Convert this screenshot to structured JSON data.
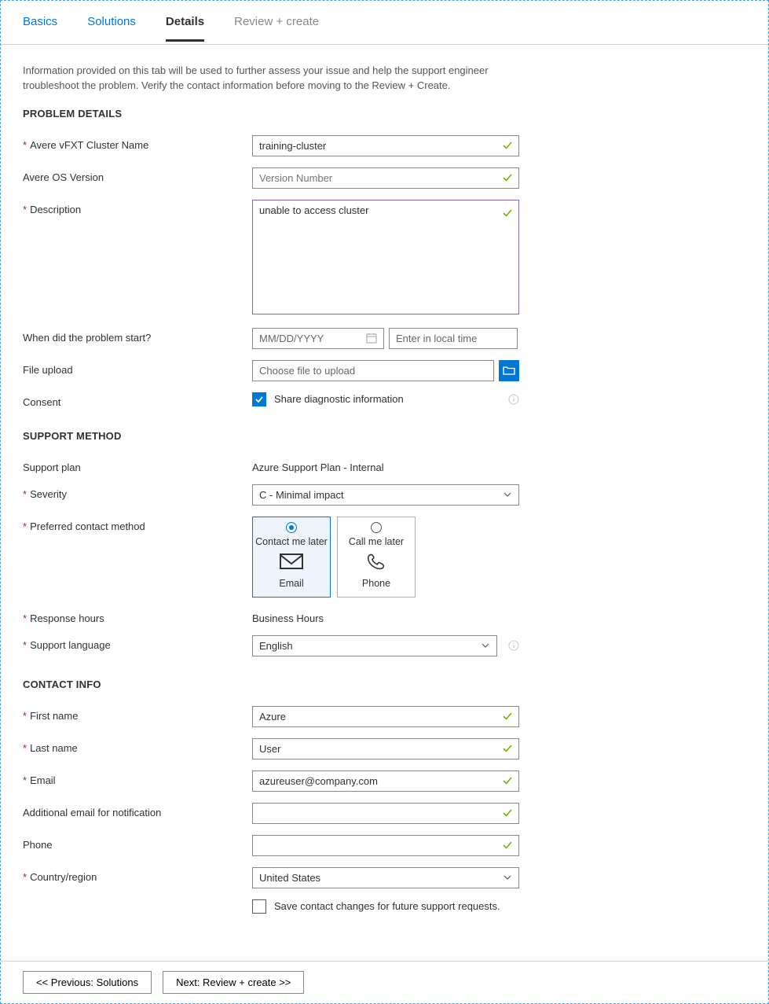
{
  "tabs": {
    "basics": "Basics",
    "solutions": "Solutions",
    "details": "Details",
    "review": "Review + create"
  },
  "intro": "Information provided on this tab will be used to further assess your issue and help the support engineer troubleshoot the problem. Verify the contact information before moving to the Review + Create.",
  "sections": {
    "problem": "PROBLEM DETAILS",
    "support": "SUPPORT METHOD",
    "contact": "CONTACT INFO"
  },
  "labels": {
    "cluster": "Avere vFXT Cluster Name",
    "os": "Avere OS Version",
    "desc": "Description",
    "when": "When did the problem start?",
    "file": "File upload",
    "consent": "Consent",
    "plan": "Support plan",
    "severity": "Severity",
    "pref": "Preferred contact method",
    "resp": "Response hours",
    "lang": "Support language",
    "first": "First name",
    "last": "Last name",
    "email": "Email",
    "addl": "Additional email for notification",
    "phone": "Phone",
    "country": "Country/region"
  },
  "values": {
    "cluster": "training-cluster",
    "desc": "unable to access cluster",
    "plan": "Azure Support Plan - Internal",
    "severity": "C - Minimal impact",
    "resp": "Business Hours",
    "lang": "English",
    "first": "Azure",
    "last": "User",
    "email": "azureuser@company.com",
    "addl": "",
    "phone": "",
    "country": "United States"
  },
  "placeholders": {
    "os": "Version Number",
    "date": "MM/DD/YYYY",
    "time": "Enter in local time",
    "file": "Choose file to upload"
  },
  "consent_text": "Share diagnostic information",
  "contact_cards": {
    "later": "Contact me later",
    "call": "Call me later",
    "email": "Email",
    "phone": "Phone"
  },
  "save_future": "Save contact changes for future support requests.",
  "footer": {
    "prev": "<< Previous: Solutions",
    "next": "Next: Review + create >>"
  }
}
